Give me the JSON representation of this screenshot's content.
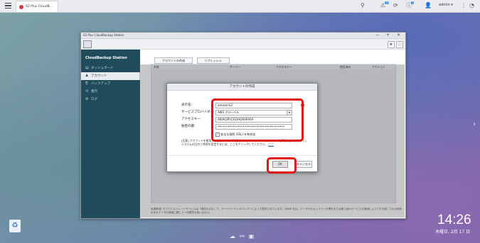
{
  "taskbar": {
    "app_tab_label": "S3 Plus CloudB...",
    "user_label": "admin ▾",
    "notification_badge": "10",
    "update_badge": "1"
  },
  "window": {
    "title": "S3 Plus CloudBackup Station",
    "controls": "− + ×"
  },
  "sidebar": {
    "title": "CloudBackup Station",
    "items": [
      {
        "label": "ダッシュボード",
        "icon": "dashboard-icon",
        "glyph": "▤"
      },
      {
        "label": "アカウント",
        "icon": "user-icon",
        "glyph": "♟"
      },
      {
        "label": "バックアップ",
        "icon": "backup-icon",
        "glyph": "⎘"
      },
      {
        "label": "復元",
        "icon": "restore-icon",
        "glyph": "⟲"
      },
      {
        "label": "ログ",
        "icon": "log-icon",
        "glyph": "⚙"
      }
    ]
  },
  "toolbar_buttons": {
    "create_account": "アカウントの作成",
    "refresh": "リフレッシュ"
  },
  "table": {
    "columns": [
      "名前",
      "サーバー",
      "アクセスキー",
      "使用済み",
      "アクション"
    ]
  },
  "footer_note": "免責事項: クラウドストレージサービスは「現状のまま」で、サードパーティのベンダーによって提供されています。QNAP 社は、データのセキュリティや損失または第三者のサービスの使用によって引き起こされる紛失のあるデータの損傷に関して一切責任を負いません。",
  "dialog": {
    "title": "アカウントの作成",
    "fields": {
      "display_name_label": "表示名:",
      "display_name_value": "amazonS3",
      "provider_label": "サービスプロバイダー:",
      "provider_value": "AWS グローバル",
      "access_key_label": "アクセスキー:",
      "access_key_value": "AKIAIQRYL3S5HDRA6X6A",
      "secret_key_label": "秘密の鍵:",
      "secret_key_value": "••••••••••••••••••••••••••••••••••••••••"
    },
    "checkbox_label": "安全な接続 (SSL) を有効化",
    "note": "[注意] アカウントを使用する前にシステム時間とインターネットタイムサーバーを同期させてください。システムの日付と時刻を設定するには、ここをクリックしてください。",
    "note_link": "ここ",
    "ok_label": "OK",
    "cancel_label": "キャンセル"
  },
  "desktop": {
    "time": "14:26",
    "date": "木曜日, 2月 17 日"
  }
}
